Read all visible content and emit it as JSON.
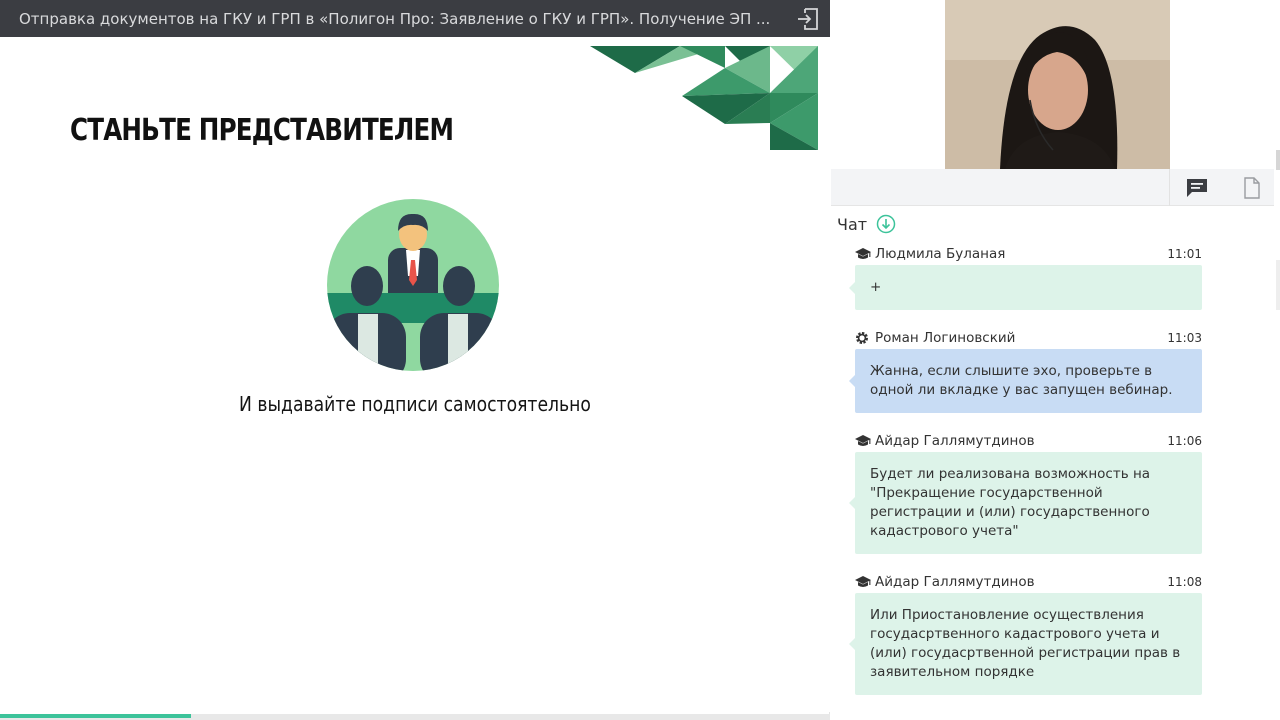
{
  "window": {
    "title": "Отправка документов на ГКУ и ГРП в «Полигон Про: Заявление о ГКУ и ГРП». Получение ЭП ...",
    "exit_icon": "sign-out-icon"
  },
  "slide": {
    "heading": "СТАНЬТЕ ПРЕДСТАВИТЕЛЕМ",
    "caption": "И выдавайте подписи самостоятельно",
    "colors": {
      "dark_green": "#1e6b48",
      "mid_green": "#3d9a6b",
      "light_green": "#8fd0a6",
      "circle": "#8fd8a0",
      "desk": "#1f8a66"
    }
  },
  "progress": {
    "fraction": 0.23,
    "color": "#3cc39a"
  },
  "toolbar": {
    "chat_icon": "chat-icon",
    "files_icon": "document-icon"
  },
  "chat": {
    "title": "Чат",
    "download_icon": "download-icon",
    "messages": [
      {
        "author": "Людмила Буланая",
        "time": "11:01",
        "role": "graduation-cap-icon",
        "text": "+",
        "style": "green"
      },
      {
        "author": "Роман Логиновский",
        "time": "11:03",
        "role": "gear-icon",
        "text": "Жанна, если слышите эхо, проверьте в одной ли вкладке у вас запущен вебинар.",
        "style": "blue"
      },
      {
        "author": "Айдар Галлямутдинов",
        "time": "11:06",
        "role": "graduation-cap-icon",
        "text": "Будет ли реализована возможность на \"Прекращение государственной регистрации и (или) государственного кадастрового учета\"",
        "style": "green"
      },
      {
        "author": "Айдар Галлямутдинов",
        "time": "11:08",
        "role": "graduation-cap-icon",
        "text": "Или Приостановление осуществления госудасртвенного кадастрового учета и (или) госудасртвенной регистрации прав в заявительном порядке",
        "style": "green"
      }
    ]
  }
}
